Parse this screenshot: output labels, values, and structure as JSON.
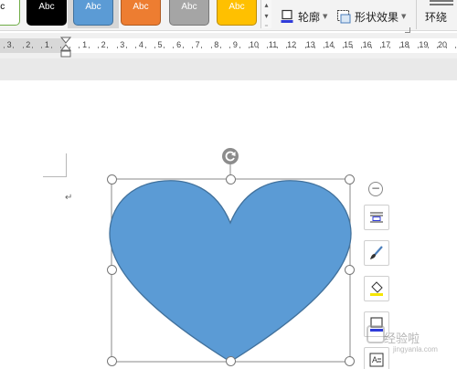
{
  "ribbon": {
    "shape_styles": [
      {
        "label": "bc",
        "bg": "#ffffff",
        "border": "#70ad47",
        "fg": "#000000"
      },
      {
        "label": "Abc",
        "bg": "#000000",
        "border": "#000000",
        "fg": "#ffffff"
      },
      {
        "label": "Abc",
        "bg": "#5b9bd5",
        "border": "#41719c",
        "fg": "#ffffff"
      },
      {
        "label": "Abc",
        "bg": "#ed7d31",
        "border": "#ae5a21",
        "fg": "#ffffff"
      },
      {
        "label": "Abc",
        "bg": "#a5a5a5",
        "border": "#787878",
        "fg": "#ffffff"
      },
      {
        "label": "Abc",
        "bg": "#ffc000",
        "border": "#bc8c00",
        "fg": "#ffffff"
      }
    ],
    "outline_label": "轮廓",
    "effects_label": "形状效果",
    "wrap_label": "环绕"
  },
  "ruler": {
    "left_numbers": [
      "3",
      "2",
      "1"
    ],
    "right_numbers": [
      "1",
      "2",
      "3",
      "4",
      "5",
      "6",
      "7",
      "8",
      "9",
      "10",
      "11",
      "12",
      "13",
      "14",
      "15",
      "16",
      "17",
      "18",
      "19",
      "20"
    ]
  },
  "document": {
    "paragraph_mark": "↵",
    "shape_fill": "#5b9bd5",
    "shape_outline": "#41719c",
    "shape_name": "heart"
  },
  "float_toolbar": {
    "collapse_label": "−"
  },
  "watermark": {
    "text": "经验啦",
    "url": "jingyanla.com"
  }
}
